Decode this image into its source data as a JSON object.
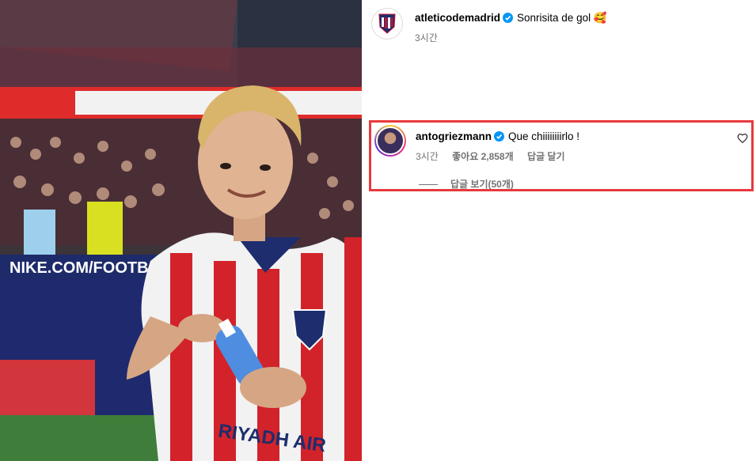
{
  "post": {
    "username": "atleticodemadrid",
    "caption": "Sonrisita de gol 🥰",
    "time": "3시간"
  },
  "comment": {
    "username": "antogriezmann",
    "text": "Que chiiiiiiiirlo !",
    "time": "3시간",
    "likes": "좋아요 2,858개",
    "reply": "답글 달기",
    "view_replies": "답글 보기(50개)"
  },
  "photo": {
    "ad_board": "NIKE.COM/FOOTBALL",
    "sponsor": "RIYADH AIR"
  },
  "colors": {
    "highlight": "#e8393c",
    "verified": "#0095f6",
    "muted": "#737373"
  }
}
